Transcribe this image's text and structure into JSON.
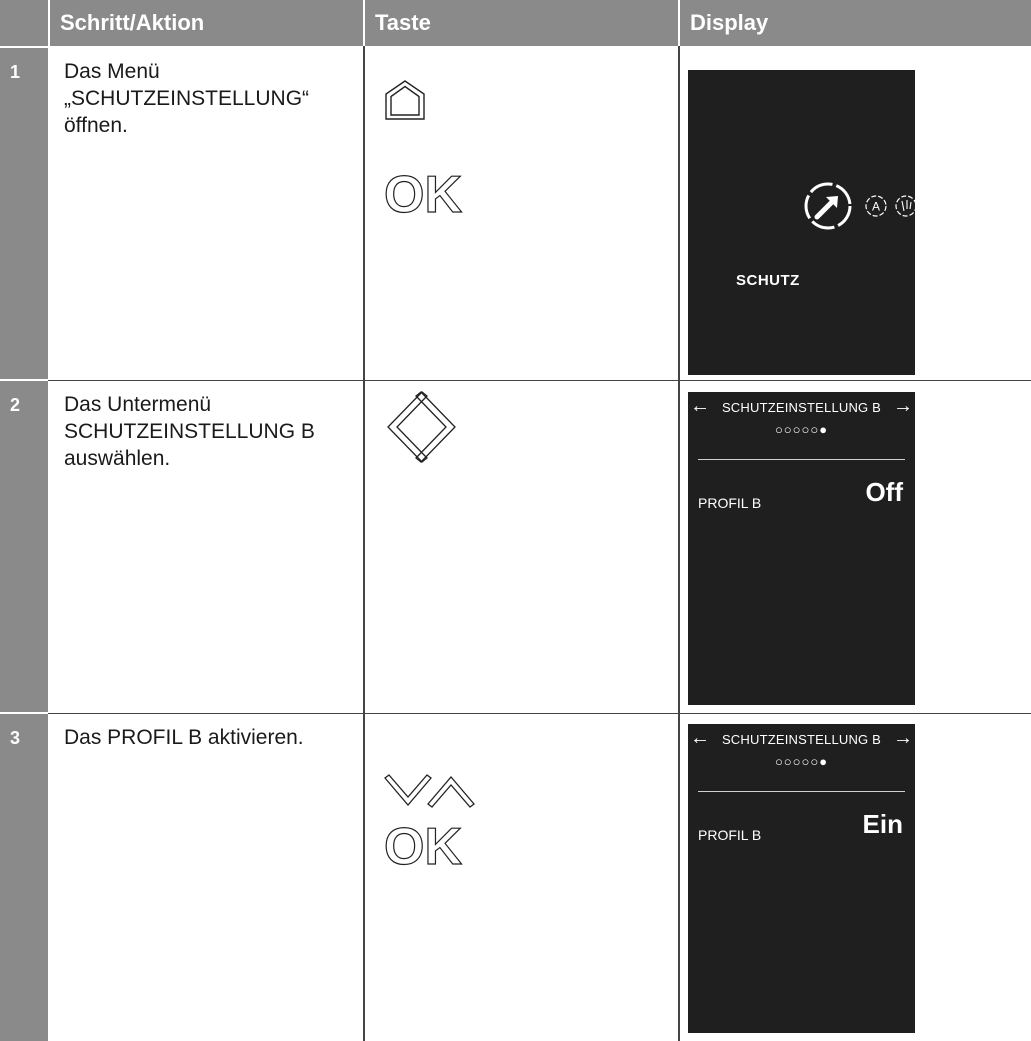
{
  "table": {
    "headers": {
      "number": "",
      "step": "Schritt/Aktion",
      "key": "Taste",
      "display": "Display"
    },
    "rows": [
      {
        "number": "1",
        "step_lines": [
          "Das Menü",
          "„SCHUTZEINSTELLUNG“",
          "öffnen."
        ],
        "keys": [
          "home-icon",
          "ok-icon"
        ],
        "display": {
          "type": "menu",
          "label": "SCHUTZ",
          "icons": [
            "protection-gauge-icon",
            "a-circle-icon",
            "partial-circle-icon"
          ]
        }
      },
      {
        "number": "2",
        "step_lines": [
          "Das Untermenü",
          "SCHUTZEINSTELLUNG B",
          "auswählen."
        ],
        "keys": [
          "left-icon",
          "right-icon"
        ],
        "display": {
          "type": "setting",
          "title": "SCHUTZEINSTELLUNG B",
          "dots": "○○○○○●",
          "label": "PROFIL B",
          "value": "Off",
          "arrows": [
            "←",
            "→"
          ]
        }
      },
      {
        "number": "3",
        "step_lines": [
          "Das PROFIL B aktivieren."
        ],
        "keys": [
          "down-icon",
          "up-icon",
          "ok-icon"
        ],
        "display": {
          "type": "setting",
          "title": "SCHUTZEINSTELLUNG B",
          "dots": "○○○○○●",
          "label": "PROFIL B",
          "value": "Ein",
          "arrows": [
            "←",
            "→"
          ]
        }
      }
    ]
  },
  "key_glyphs": {
    "ok": "OK"
  },
  "colors": {
    "header_bg": "#8a8a8a",
    "screen_bg": "#1f1f1f",
    "text": "#1a1a1a"
  }
}
